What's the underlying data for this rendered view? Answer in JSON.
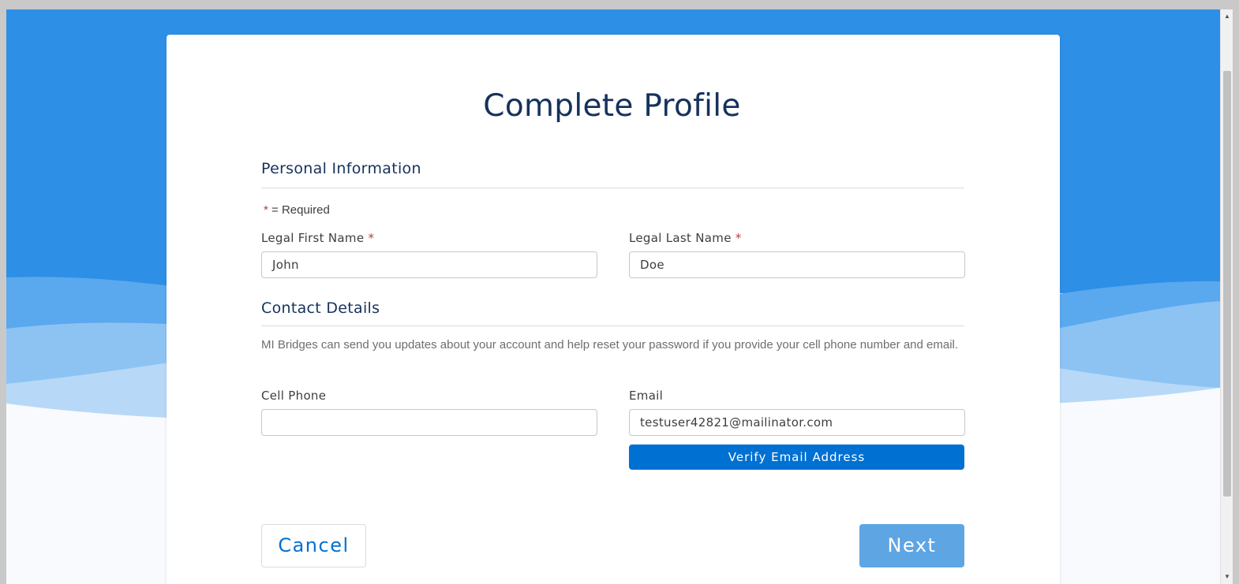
{
  "page": {
    "title": "Complete Profile"
  },
  "personal": {
    "heading": "Personal Information",
    "required_marker": "*",
    "required_legend": "= Required",
    "first_name_label": "Legal First Name",
    "first_name_value": "John",
    "last_name_label": "Legal Last Name",
    "last_name_value": "Doe"
  },
  "contact": {
    "heading": "Contact Details",
    "description": "MI Bridges can send you updates about your account and help reset your password if you provide your cell phone number and email.",
    "cell_label": "Cell Phone",
    "cell_value": "",
    "email_label": "Email",
    "email_value": "testuser42821@mailinator.com",
    "verify_label": "Verify Email Address"
  },
  "actions": {
    "cancel_label": "Cancel",
    "next_label": "Next"
  },
  "colors": {
    "header_blue": "#2d8fe6",
    "title_navy": "#16325c",
    "primary_button": "#0070d2",
    "next_disabled": "#5ea5e4",
    "required_red": "#c23934"
  }
}
